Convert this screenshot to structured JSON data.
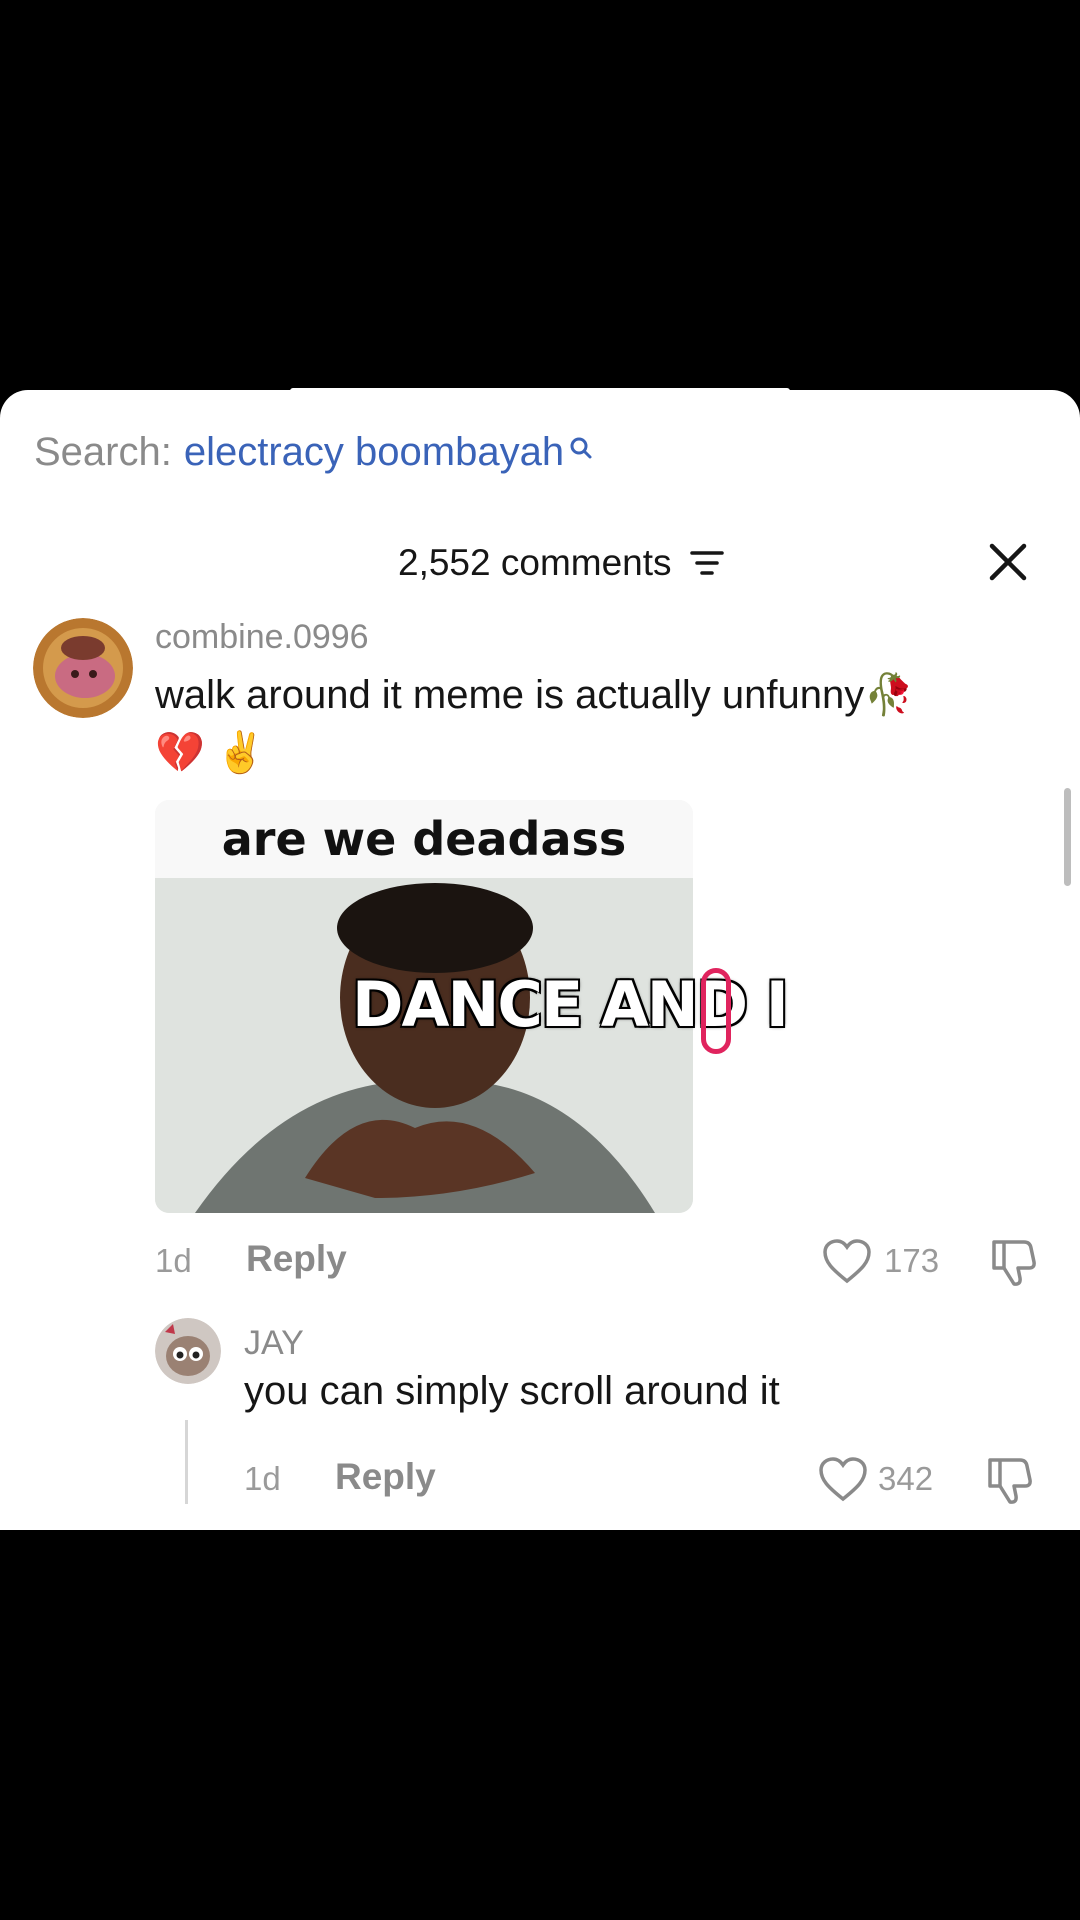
{
  "search": {
    "prefix": "Search:",
    "term": "electracy boombayah"
  },
  "header": {
    "count_label": "2,552 comments"
  },
  "comments": [
    {
      "username": "combine.0996",
      "text_line1": "walk around it meme is actually unfunny🥀",
      "text_line2": "💔 ✌️",
      "image": {
        "top_caption": "are we deadass",
        "overlay_text": "DANCE AND I"
      },
      "time": "1d",
      "reply_label": "Reply",
      "likes": "173"
    },
    {
      "username": "JAY",
      "text": "you can simply scroll around it",
      "time": "1d",
      "reply_label": "Reply",
      "likes": "342"
    }
  ],
  "colors": {
    "accent": "#3a63b8",
    "cursor": "#e0245e",
    "muted": "#8a8a8a"
  }
}
